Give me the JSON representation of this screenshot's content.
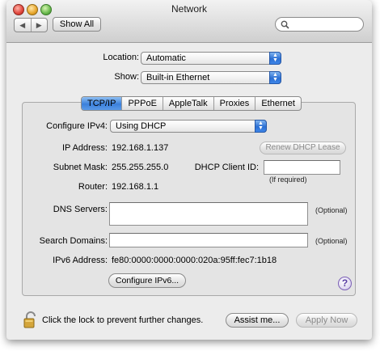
{
  "window": {
    "title": "Network"
  },
  "toolbar": {
    "back_glyph": "◀",
    "forward_glyph": "▶",
    "show_all_label": "Show All",
    "search_placeholder": ""
  },
  "location": {
    "label": "Location:",
    "value": "Automatic"
  },
  "show": {
    "label": "Show:",
    "value": "Built-in Ethernet"
  },
  "tabs": [
    {
      "label": "TCP/IP",
      "active": true
    },
    {
      "label": "PPPoE",
      "active": false
    },
    {
      "label": "AppleTalk",
      "active": false
    },
    {
      "label": "Proxies",
      "active": false
    },
    {
      "label": "Ethernet",
      "active": false
    }
  ],
  "tcpip": {
    "configure_label": "Configure IPv4:",
    "configure_value": "Using DHCP",
    "ip_label": "IP Address:",
    "ip_value": "192.168.1.137",
    "renew_label": "Renew DHCP Lease",
    "subnet_label": "Subnet Mask:",
    "subnet_value": "255.255.255.0",
    "dhcp_client_label": "DHCP Client ID:",
    "dhcp_client_value": "",
    "if_required": "(If required)",
    "router_label": "Router:",
    "router_value": "192.168.1.1",
    "dns_label": "DNS Servers:",
    "dns_optional": "(Optional)",
    "search_label": "Search Domains:",
    "search_optional": "(Optional)",
    "ipv6_label": "IPv6 Address:",
    "ipv6_value": "fe80:0000:0000:0000:020a:95ff:fec7:1b18",
    "configure_ipv6_label": "Configure IPv6...",
    "help_glyph": "?"
  },
  "footer": {
    "lock_text": "Click the lock to prevent further changes.",
    "assist_label": "Assist me...",
    "apply_label": "Apply Now"
  },
  "colors": {
    "accent_blue": "#3b80db",
    "lock_gold": "#d4a53a"
  }
}
